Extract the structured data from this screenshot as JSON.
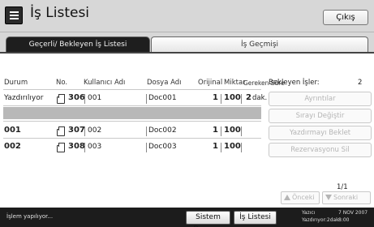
{
  "header": {
    "title": "İş Listesi",
    "exit_label": "Çıkış"
  },
  "tabs": [
    {
      "label": "Geçerli/ Bekleyen İş Listesi",
      "active": true
    },
    {
      "label": "İş Geçmişi",
      "active": false
    }
  ],
  "table": {
    "columns": [
      "Durum",
      "No.",
      "Kullanıcı Adı",
      "Dosya Adı",
      "Orijinal",
      "Miktar",
      "Gereken Süre"
    ],
    "rows": [
      {
        "status": "Yazdırılıyor",
        "no": "306",
        "user": "001",
        "file": "Doc001",
        "original": "1",
        "quantity": "100",
        "time": "2",
        "time_unit": "dak."
      },
      {
        "status": "001",
        "no": "307",
        "user": "002",
        "file": "Doc002",
        "original": "1",
        "quantity": "100",
        "time": "",
        "time_unit": ""
      },
      {
        "status": "002",
        "no": "308",
        "user": "003",
        "file": "Doc003",
        "original": "1",
        "quantity": "100",
        "time": "",
        "time_unit": ""
      }
    ]
  },
  "side_panel": {
    "label": "Bekleyen İşler:",
    "count": "2",
    "buttons": [
      "Ayrıntılar",
      "Sırayı Değiştir",
      "Yazdırmayı Beklet",
      "Rezervasyonu Sil"
    ]
  },
  "pagination": {
    "indicator": "1/1",
    "prev_label": "Önceki",
    "next_label": "Sonraki"
  },
  "status_bar": {
    "message": "İşlem yapılıyor...",
    "system_status_label": "Sistem Durumu",
    "job_list_label": "İş Listesi",
    "printer_label": "Yazıcı",
    "printer_state": "Yazdırıyor:2dak",
    "date": "7 NOV 2007",
    "time": "8:00"
  },
  "colors": {
    "active_tab": "#1e1e1e",
    "statusbar": "#1c1c1c",
    "highlight_row": "#b8b8b8",
    "disabled_text": "#b5b5b5"
  }
}
